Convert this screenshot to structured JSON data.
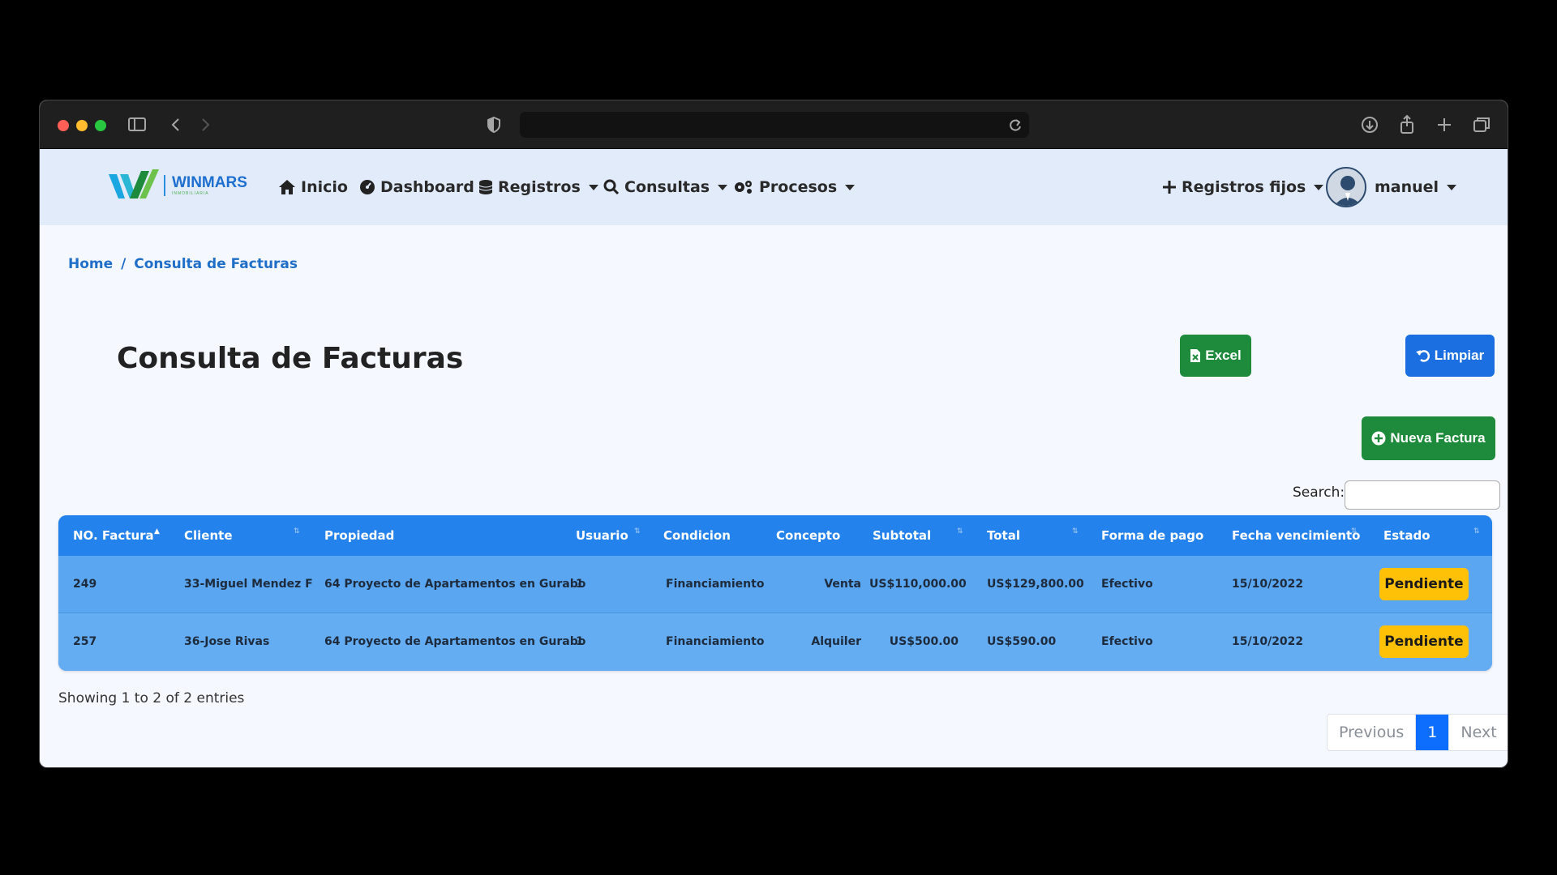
{
  "nav": {
    "logo_text": "WINMARS",
    "logo_sub": "INMOBILIARIA",
    "items": [
      {
        "label": "Inicio",
        "icon": "home-icon"
      },
      {
        "label": "Dashboard",
        "icon": "dashboard-icon"
      },
      {
        "label": "Registros",
        "icon": "database-icon"
      },
      {
        "label": "Consultas",
        "icon": "search-icon"
      },
      {
        "label": "Procesos",
        "icon": "gears-icon"
      }
    ],
    "registros_fijos": "Registros fijos",
    "user": "manuel"
  },
  "breadcrumb": {
    "home": "Home",
    "separator": "/",
    "current": "Consulta de Facturas"
  },
  "page": {
    "title": "Consulta de Facturas",
    "excel_label": "Excel",
    "limpiar_label": "Limpiar",
    "nueva_label": "Nueva Factura",
    "search_label": "Search:",
    "search_value": ""
  },
  "table": {
    "columns": [
      "NO. Factura",
      "Cliente",
      "Propiedad",
      "Usuario",
      "Condicion",
      "Concepto",
      "Subtotal",
      "Total",
      "Forma de pago",
      "Fecha vencimiento",
      "Estado"
    ],
    "rows": [
      {
        "no": "249",
        "cliente": "33-Miguel Mendez F",
        "propiedad": "64 Proyecto de Apartamentos en Gurabo",
        "usuario": "1",
        "condicion": "Financiamiento",
        "concepto": "Venta",
        "subtotal": "US$110,000.00",
        "total": "US$129,800.00",
        "forma": "Efectivo",
        "fecha": "15/10/2022",
        "estado": "Pendiente"
      },
      {
        "no": "257",
        "cliente": "36-Jose Rivas",
        "propiedad": "64 Proyecto de Apartamentos en Gurabo",
        "usuario": "1",
        "condicion": "Financiamiento",
        "concepto": "Alquiler",
        "subtotal": "US$500.00",
        "total": "US$590.00",
        "forma": "Efectivo",
        "fecha": "15/10/2022",
        "estado": "Pendiente"
      }
    ]
  },
  "footer": {
    "entries": "Showing 1 to 2 of 2 entries",
    "previous": "Previous",
    "page": "1",
    "next": "Next"
  },
  "colors": {
    "primary": "#1c6fe0",
    "success": "#1e8a3b",
    "warning": "#ffc107",
    "table_head": "#2482ec",
    "table_row": "#5aa6f0"
  }
}
